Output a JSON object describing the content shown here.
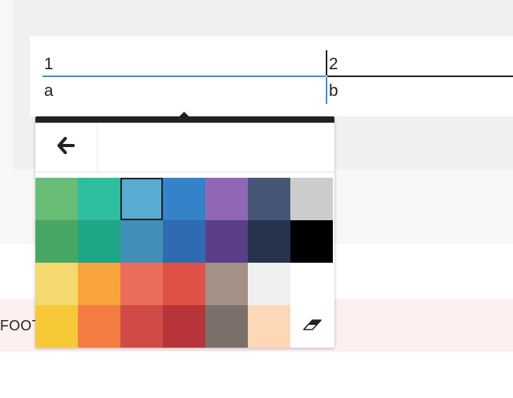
{
  "table": {
    "cells": [
      {
        "text": "1"
      },
      {
        "text": "2"
      },
      {
        "text": "a"
      },
      {
        "text": "b"
      }
    ]
  },
  "footer": {
    "text": "FOOT"
  },
  "picker": {
    "back_icon": "arrow-left-icon",
    "eraser_icon": "eraser-icon",
    "selected_color": "#5aabd1",
    "colors": [
      [
        "#67bd76",
        "#2dbd9f",
        "#5aabd1",
        "#3483c8",
        "#9067b5",
        "#465676",
        "#cccccc"
      ],
      [
        "#48a663",
        "#1fa686",
        "#428fb8",
        "#2f6bb0",
        "#5a3f87",
        "#27334c",
        "#000000"
      ],
      [
        "#f5d86e",
        "#f8a43c",
        "#ea6c5b",
        "#e05248",
        "#a39087",
        "#efefef",
        "#ffffff"
      ],
      [
        "#f7c838",
        "#f27c41",
        "#d24a45",
        "#b73538",
        "#7c706a",
        "#fdd7b6",
        null
      ]
    ]
  }
}
